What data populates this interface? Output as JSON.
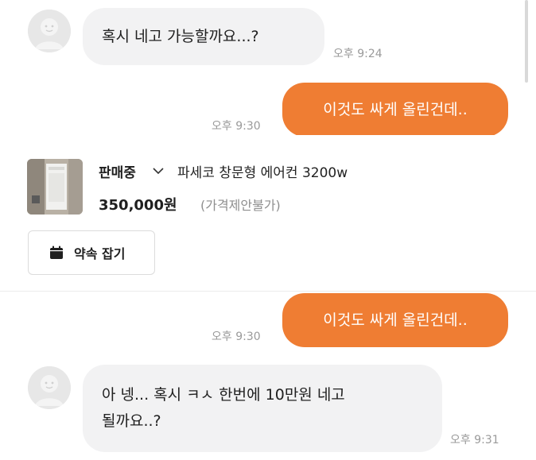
{
  "messages": {
    "m1": {
      "text": "혹시 네고 가능할까요...?",
      "time": "오후 9:24"
    },
    "m2": {
      "text": "이것도 싸게 올린건데..",
      "time": "오후 9:30"
    },
    "m3": {
      "text": "이것도 싸게 올린건데..",
      "time": "오후 9:30"
    },
    "m4": {
      "line1": "아 넹... 혹시 ㅋㅅ 한번에 10만원 네고",
      "line2": "될까요..?",
      "time": "오후 9:31"
    }
  },
  "product": {
    "status": "판매중",
    "title": "파세코 창문형 에어컨 3200w",
    "price": "350,000원",
    "price_note": "(가격제안불가)",
    "appointment_label": "약속 잡기"
  },
  "colors": {
    "outgoing_bubble": "#ef7d33",
    "incoming_bubble": "#f2f2f3",
    "timestamp": "#9a9a9a"
  },
  "icons": {
    "avatar": "user-avatar-icon",
    "status_dropdown": "chevron-down-icon",
    "appointment": "calendar-icon"
  }
}
